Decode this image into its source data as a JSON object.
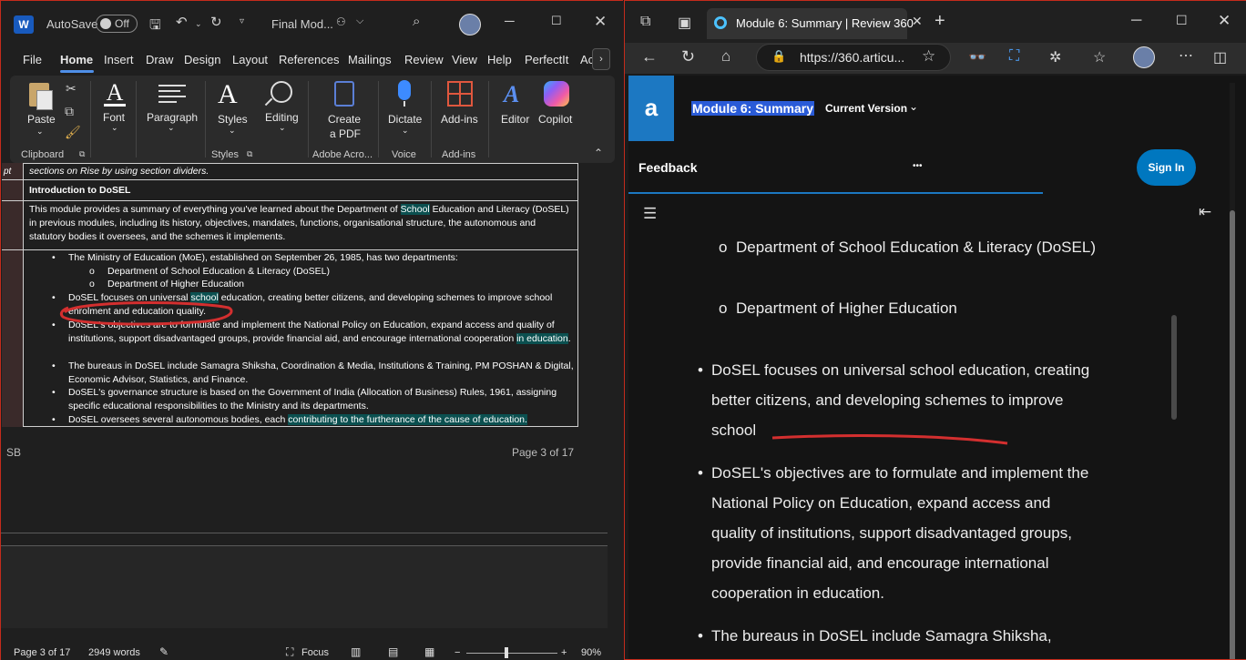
{
  "word": {
    "title_bar": {
      "app_icon": "W",
      "autosave_label": "AutoSave",
      "autosave_state": "Off",
      "doc_title": "Final Mod...",
      "icons": [
        "save-icon",
        "undo-icon",
        "redo-icon",
        "customize-icon",
        "coauthor-icon",
        "search-icon",
        "profile-icon",
        "minimize-icon",
        "maximize-icon",
        "close-icon"
      ]
    },
    "menu": [
      "File",
      "Home",
      "Insert",
      "Draw",
      "Design",
      "Layout",
      "References",
      "Mailings",
      "Review",
      "View",
      "Help",
      "PerfectIt",
      "Ac"
    ],
    "ribbon": {
      "paste": "Paste",
      "clipboard": "Clipboard",
      "font": "Font",
      "paragraph": "Paragraph",
      "styles": "Styles",
      "styles_group": "Styles",
      "editing": "Editing",
      "create_pdf_1": "Create",
      "create_pdf_2": "a PDF",
      "adobe_group": "Adobe Acro...",
      "dictate": "Dictate",
      "voice_group": "Voice",
      "addins": "Add-ins",
      "addins_group": "Add-ins",
      "editor": "Editor",
      "copilot": "Copilot"
    },
    "doc": {
      "left_cell": "pt",
      "row0": "sections on Rise by using section dividers.",
      "heading": "Introduction to DoSEL",
      "para_a": "This module provides a summary of everything you've learned about the Department of ",
      "para_hl": "School",
      "para_b": " Education and Literacy (DoSEL) in previous modules, including its history, objectives, mandates, functions, organisational structure, the autonomous and statutory bodies it oversees, and the schemes it implements.",
      "b1": "The Ministry of Education (MoE), established on September 26, 1985, has two departments:",
      "b1a": "Department of School Education & Literacy (DoSEL)",
      "b1b": "Department of Higher Education",
      "b2a": "DoSEL focuses on universal ",
      "b2hl": "school",
      "b2b": " education, creating better citizens, and developing schemes to improve school enrolment and education quality.",
      "b3a": "DoSEL's objectives are to formulate and implement the National Policy on Education, expand access and quality of institutions, support disadvantaged groups, provide financial aid, and encourage international cooperation ",
      "b3hl": "in education",
      "b3b": ".",
      "b4": "The bureaus in DoSEL include Samagra Shiksha, Coordination & Media, Institutions & Training, PM POSHAN & Digital, Economic Advisor, Statistics, and Finance.",
      "b5": "DoSEL's governance structure is based on the Government of India (Allocation of Business) Rules, 1961, assigning specific educational responsibilities to the Ministry and its departments.",
      "b6a": "DoSEL oversees several autonomous bodies, each ",
      "b6hl": "contributing to the furtherance of the cause of education.",
      "footer_left": "SB",
      "footer_right": "Page 3 of 17"
    },
    "status": {
      "page": "Page 3 of 17",
      "words": "2949 words",
      "focus": "Focus",
      "zoom": "90%",
      "zoom_level": 0.9
    }
  },
  "browser": {
    "tab_title": "Module 6: Summary | Review 360",
    "url": "https://360.articu...",
    "site": {
      "logo": "a",
      "title": "Module 6: Summary",
      "version": "Current Version",
      "feedback": "Feedback",
      "more": "•••",
      "signin": "Sign In"
    },
    "content": {
      "sub1": "Department of School Education & Literacy (DoSEL)",
      "sub2": "Department of Higher Education",
      "b1_l1": "DoSEL focuses on universal school education, creating",
      "b1_l2": "better citizens, and developing schemes to improve",
      "b1_l3": "school",
      "b2_l1": "DoSEL's objectives are to formulate and implement the",
      "b2_l2": "National Policy on Education, expand access and",
      "b2_l3": "quality of institutions, support disadvantaged groups,",
      "b2_l4": "provide financial aid, and encourage international",
      "b2_l5": "cooperation in education.",
      "b3_l1": "The bureaus in DoSEL include Samagra Shiksha,"
    }
  }
}
